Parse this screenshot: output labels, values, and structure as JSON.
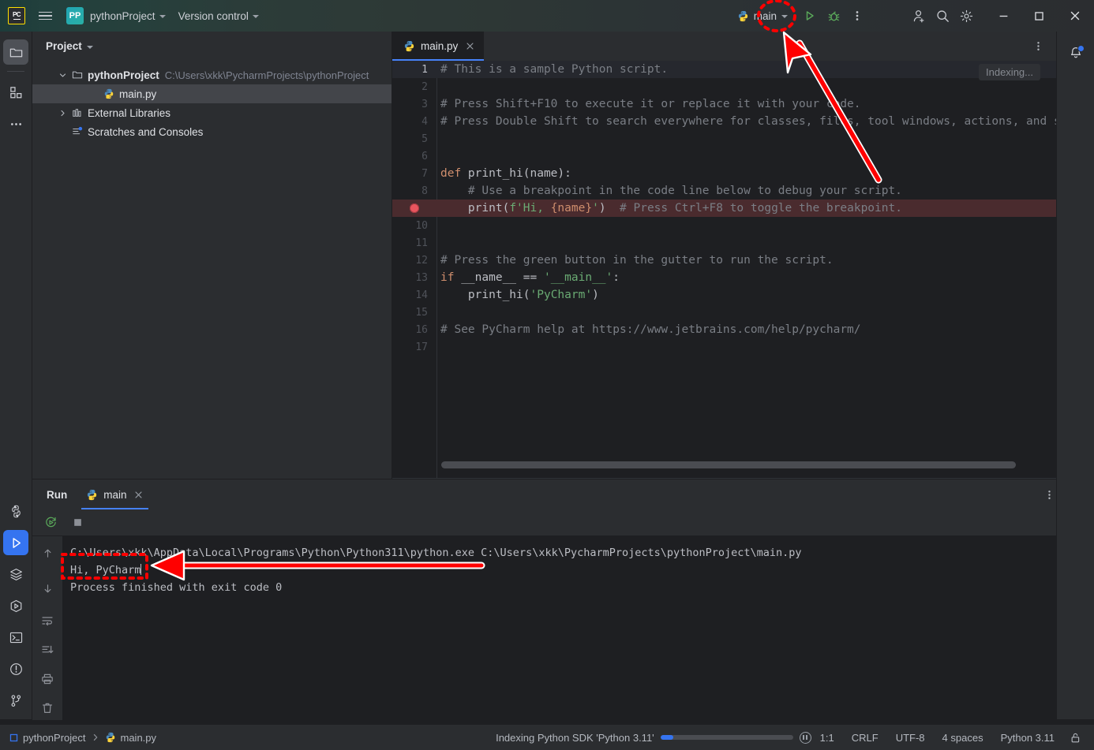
{
  "window": {
    "app_logo": "pycharm-logo",
    "project_badge": "PP",
    "project_name": "pythonProject",
    "version_control": "Version control",
    "menu_icon": "hamburger-menu-icon"
  },
  "toolbar": {
    "run_config_name": "main",
    "run_icon": "run-triangle-icon",
    "debug_icon": "debug-bug-icon",
    "more_icon": "more-vertical-icon",
    "account_icon": "add-user-icon",
    "search_icon": "search-icon",
    "settings_icon": "gear-icon",
    "minimize_icon": "minimize-icon",
    "maximize_icon": "maximize-icon",
    "close_icon": "close-icon"
  },
  "left_rail": {
    "top": [
      {
        "name": "project-tool-window",
        "icon": "folder-icon",
        "selected": true
      },
      {
        "name": "structure-tool-window",
        "icon": "grid-blocks-icon",
        "selected": false
      },
      {
        "name": "more-tool-windows",
        "icon": "ellipsis-icon",
        "selected": false
      }
    ],
    "bottom": [
      {
        "name": "python-console",
        "icon": "python-icon",
        "active": false
      },
      {
        "name": "run-tool-window",
        "icon": "run-triangle-icon",
        "active": true
      },
      {
        "name": "services-tool-window",
        "icon": "layers-icon",
        "active": false
      },
      {
        "name": "debug-tool-window",
        "icon": "debug-play-icon",
        "active": false
      },
      {
        "name": "terminal-tool-window",
        "icon": "terminal-icon",
        "active": false
      },
      {
        "name": "problems-tool-window",
        "icon": "warning-circle-icon",
        "active": false
      },
      {
        "name": "version-control-tool-window",
        "icon": "git-branch-icon",
        "active": false
      }
    ]
  },
  "project_panel": {
    "title": "Project",
    "tree": [
      {
        "label": "pythonProject",
        "path": "C:\\Users\\xkk\\PycharmProjects\\pythonProject",
        "icon": "folder-icon",
        "expanded": true,
        "depth": 0,
        "bold": true,
        "selected": false
      },
      {
        "label": "main.py",
        "path": "",
        "icon": "python-file-icon",
        "expanded": null,
        "depth": 1,
        "bold": false,
        "selected": true
      },
      {
        "label": "External Libraries",
        "path": "",
        "icon": "library-icon",
        "expanded": false,
        "depth": 0,
        "bold": false,
        "selected": false
      },
      {
        "label": "Scratches and Consoles",
        "path": "",
        "icon": "scratches-icon",
        "expanded": null,
        "depth": 0,
        "bold": false,
        "selected": false
      }
    ]
  },
  "editor": {
    "tab_label": "main.py",
    "tab_icon": "python-file-icon",
    "tab_close_icon": "close-icon",
    "options_icon": "more-vertical-icon",
    "indexing_chip": "Indexing...",
    "breakpoint_line": 9,
    "current_line": 1,
    "lines": [
      {
        "n": 1,
        "tokens": [
          {
            "t": "# This is a sample Python script.",
            "c": "cm"
          }
        ]
      },
      {
        "n": 2,
        "tokens": []
      },
      {
        "n": 3,
        "tokens": [
          {
            "t": "# Press Shift+F10 to execute it or replace it with your code.",
            "c": "cm"
          }
        ]
      },
      {
        "n": 4,
        "tokens": [
          {
            "t": "# Press Double Shift to search everywhere for classes, files, tool windows, actions, and settings.",
            "c": "cm"
          }
        ]
      },
      {
        "n": 5,
        "tokens": []
      },
      {
        "n": 6,
        "tokens": []
      },
      {
        "n": 7,
        "tokens": [
          {
            "t": "def ",
            "c": "kw"
          },
          {
            "t": "print_hi(name):",
            "c": "fn"
          }
        ]
      },
      {
        "n": 8,
        "tokens": [
          {
            "t": "    # Use a breakpoint in the code line below to debug your script.",
            "c": "cm"
          }
        ]
      },
      {
        "n": 9,
        "tokens": [
          {
            "t": "    print(",
            "c": "pn"
          },
          {
            "t": "f'Hi, ",
            "c": "str"
          },
          {
            "t": "{name}",
            "c": "inj"
          },
          {
            "t": "'",
            "c": "str"
          },
          {
            "t": ")",
            "c": "pn"
          },
          {
            "t": "  # Press Ctrl+F8 to toggle the breakpoint.",
            "c": "cm"
          }
        ]
      },
      {
        "n": 10,
        "tokens": []
      },
      {
        "n": 11,
        "tokens": []
      },
      {
        "n": 12,
        "tokens": [
          {
            "t": "# Press the green button in the gutter to run the script.",
            "c": "cm"
          }
        ]
      },
      {
        "n": 13,
        "tokens": [
          {
            "t": "if ",
            "c": "kw"
          },
          {
            "t": "__name__ == ",
            "c": "pn"
          },
          {
            "t": "'__main__'",
            "c": "str"
          },
          {
            "t": ":",
            "c": "pn"
          }
        ]
      },
      {
        "n": 14,
        "tokens": [
          {
            "t": "    print_hi(",
            "c": "pn"
          },
          {
            "t": "'PyCharm'",
            "c": "str"
          },
          {
            "t": ")",
            "c": "pn"
          }
        ]
      },
      {
        "n": 15,
        "tokens": []
      },
      {
        "n": 16,
        "tokens": [
          {
            "t": "# See PyCharm help at https://www.jetbrains.com/help/pycharm/",
            "c": "cm"
          }
        ]
      },
      {
        "n": 17,
        "tokens": []
      }
    ]
  },
  "run_panel": {
    "title": "Run",
    "tab_label": "main",
    "tab_icon": "python-file-icon",
    "tab_close_icon": "close-icon",
    "rerun_icon": "rerun-icon",
    "stop_icon": "stop-square-icon",
    "options_icon": "more-vertical-icon",
    "minimize_icon": "minimize-icon",
    "sidebar_icons": [
      "arrow-up-icon",
      "arrow-down-icon",
      "soft-wrap-icon",
      "scroll-to-end-icon",
      "print-icon",
      "trash-icon"
    ],
    "console": [
      "C:\\Users\\xkk\\AppData\\Local\\Programs\\Python\\Python311\\python.exe C:\\Users\\xkk\\PycharmProjects\\pythonProject\\main.py",
      "Hi, PyCharm",
      "",
      "Process finished with exit code 0"
    ]
  },
  "right_rail": {
    "notifications_icon": "bell-icon",
    "has_badge": true
  },
  "status_bar": {
    "breadcrumb_project": "pythonProject",
    "breadcrumb_file": "main.py",
    "indexing_text": "Indexing Python SDK 'Python 3.11'",
    "progress_percent": 10,
    "pause_icon": "pause-icon",
    "caret_position": "1:1",
    "line_separator": "CRLF",
    "encoding": "UTF-8",
    "indent": "4 spaces",
    "interpreter": "Python 3.11",
    "lock_icon": "unlocked-icon"
  },
  "annotations": {
    "run_button_highlight": "red-dashed-ellipse",
    "run_button_arrow": "red-arrow-pointing-up-left",
    "output_highlight": "red-dashed-rectangle",
    "output_arrow": "red-arrow-pointing-left",
    "color": "#ff0000"
  },
  "colors": {
    "accent_blue": "#3574f0",
    "run_green": "#4caf50",
    "breakpoint_red": "#e8555e",
    "annotation_red": "#ff0000",
    "bg_dark": "#1e1f22",
    "bg_panel": "#2b2d30"
  }
}
